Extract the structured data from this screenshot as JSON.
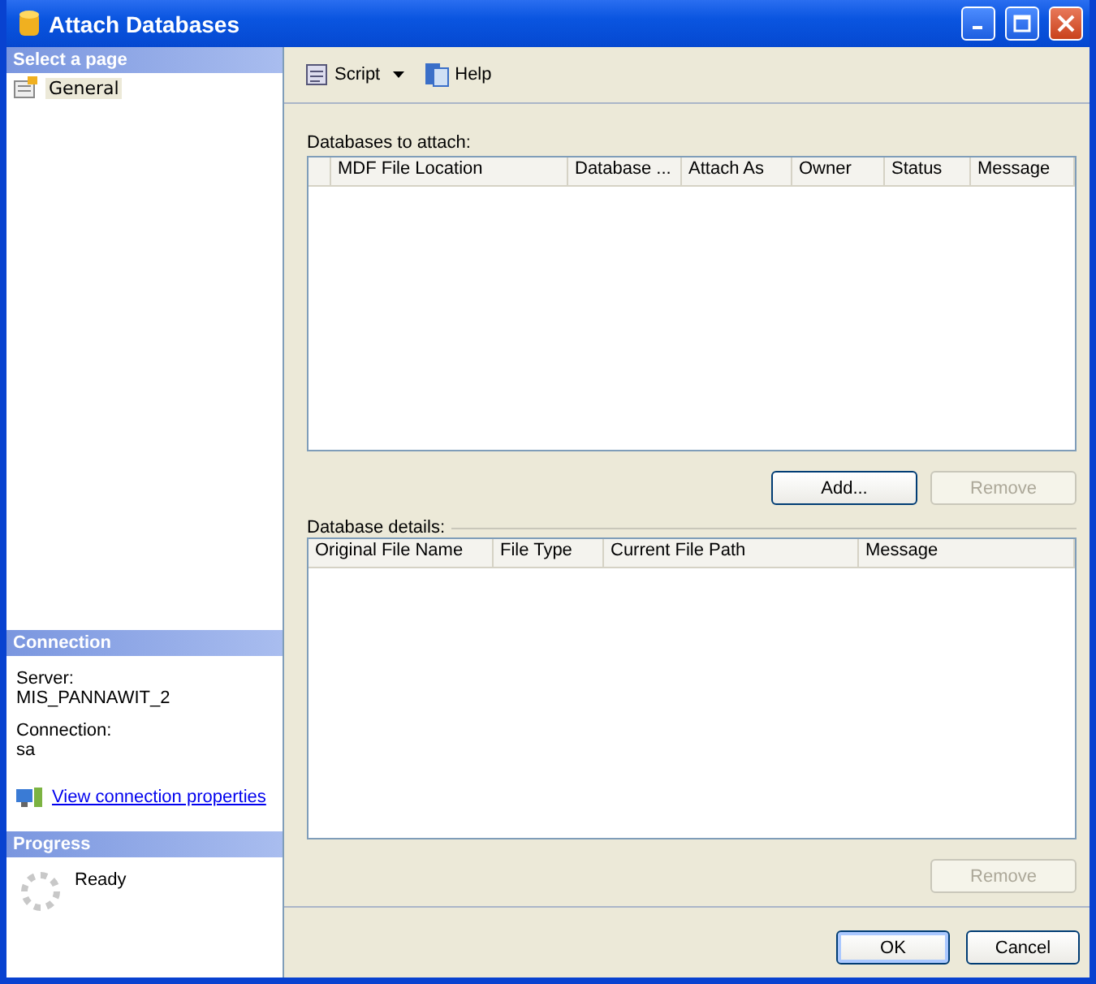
{
  "window": {
    "title": "Attach Databases"
  },
  "sidebar": {
    "select_page_header": "Select a page",
    "pages": [
      {
        "label": "General",
        "selected": true
      }
    ],
    "connection_header": "Connection",
    "connection_fields": [
      {
        "label": "Server:",
        "value": "MIS_PANNAWIT_2"
      },
      {
        "label": "Connection:",
        "value": "sa"
      }
    ],
    "connection_link": "View connection properties",
    "progress_header": "Progress",
    "progress_status": "Ready"
  },
  "toolbar": {
    "items": [
      {
        "kind": "script",
        "label": "Script"
      },
      {
        "kind": "help",
        "label": "Help"
      }
    ]
  },
  "databases_to_attach": {
    "label": "Databases to attach:",
    "columns": [
      "",
      "MDF File Location",
      "Database ...",
      "Attach As",
      "Owner",
      "Status",
      "Message"
    ],
    "buttons": [
      {
        "label": "Add...",
        "disabled": false
      },
      {
        "label": "Remove",
        "disabled": true
      }
    ]
  },
  "database_details": {
    "label": "Database details:",
    "columns": [
      "Original File Name",
      "File Type",
      "Current File Path",
      "Message"
    ],
    "buttons": [
      {
        "label": "Remove",
        "disabled": true
      }
    ]
  },
  "dialog_buttons": [
    {
      "label": "OK",
      "default": true
    },
    {
      "label": "Cancel",
      "default": false
    }
  ]
}
